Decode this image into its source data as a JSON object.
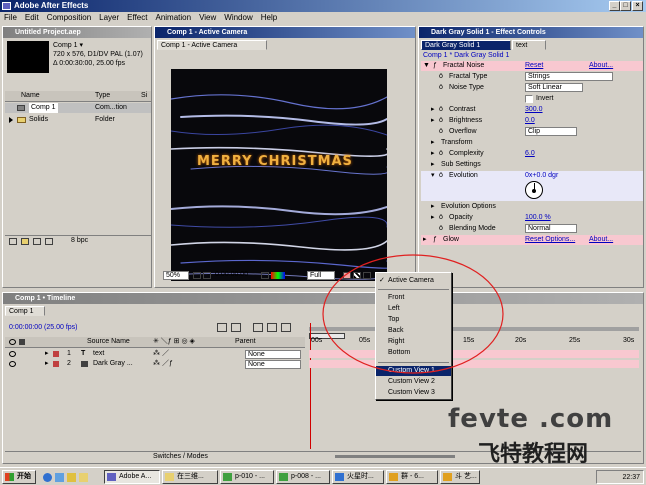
{
  "app": {
    "title": "Adobe After Effects",
    "min": "_",
    "max": "□",
    "close": "×"
  },
  "menu": [
    "File",
    "Edit",
    "Composition",
    "Layer",
    "Effect",
    "Animation",
    "View",
    "Window",
    "Help"
  ],
  "project": {
    "title": "Untitled Project.aep",
    "comp_name": "Comp 1 ▾",
    "comp_info1": "720 x 576, D1/DV PAL (1.07)",
    "comp_info2": "Δ 0:00:30:00, 25.00 fps",
    "col_name": "Name",
    "col_type": "Type",
    "col_size": "Si",
    "items": [
      {
        "name": "Comp 1",
        "type": "Com...tion"
      },
      {
        "name": "Solids",
        "type": "Folder"
      }
    ],
    "bpc": "8 bpc"
  },
  "comp_viewer": {
    "title": "Comp 1 - Active Camera",
    "tab": "Comp 1 - Active Camera",
    "text": "MERRY CHRISTMAS",
    "zoom": "50%",
    "time": "0:00:00:00",
    "resolution": "Full"
  },
  "effect_controls": {
    "title": "Dark Gray Solid 1 - Effect Controls",
    "tab1": "Dark Gray Solid 1",
    "tab2": "text",
    "breadcrumb": "Comp 1 * Dark Gray Solid 1",
    "effect_name": "Fractal Noise",
    "reset": "Reset",
    "about": "About...",
    "props": [
      {
        "label": "Fractal Type",
        "value": "Strings"
      },
      {
        "label": "Noise Type",
        "value": "Soft Linear"
      },
      {
        "label": "",
        "value": "Invert"
      },
      {
        "label": "Contrast",
        "value": "300.0"
      },
      {
        "label": "Brightness",
        "value": "0.0"
      },
      {
        "label": "Overflow",
        "value": "Clip"
      },
      {
        "label": "Transform",
        "value": ""
      },
      {
        "label": "Complexity",
        "value": "6.0"
      },
      {
        "label": "Sub Settings",
        "value": ""
      },
      {
        "label": "Evolution",
        "value": "0x+0.0 dgr"
      },
      {
        "label": "Evolution Options",
        "value": ""
      },
      {
        "label": "Opacity",
        "value": "100.0 %"
      },
      {
        "label": "Blending Mode",
        "value": "Normal"
      }
    ],
    "glow": {
      "name": "Glow",
      "reset": "Reset Options...",
      "about": "About..."
    }
  },
  "timeline": {
    "title": "Comp 1 • Timeline",
    "tab": "Comp 1",
    "time": "0:00:00:00 (25.00 fps)",
    "col_source": "Source Name",
    "col_parent": "Parent",
    "ticks": [
      "00s",
      "05s",
      "10s",
      "15s",
      "20s",
      "25s",
      "30s"
    ],
    "layers": [
      {
        "num": "1",
        "name": "text",
        "parent": "None"
      },
      {
        "num": "2",
        "name": "Dark Gray ...",
        "parent": "None"
      }
    ],
    "switches": "Switches / Modes"
  },
  "view_menu": {
    "checked": "Active Camera",
    "items": [
      "Front",
      "Left",
      "Top",
      "Back",
      "Right",
      "Bottom"
    ],
    "custom": [
      "Custom View 1",
      "Custom View 2",
      "Custom View 3"
    ],
    "selected_index": 0
  },
  "watermark": {
    "line1": "fevte .com",
    "line2": "飞特教程网"
  },
  "taskbar": {
    "start": "开始",
    "items": [
      "Adobe A...",
      "在三维...",
      "p-010 - ...",
      "p-008 - ...",
      "火星时...",
      "群 - 6...",
      "斗 艺..."
    ],
    "clock": "22:37"
  },
  "colors": {
    "accent": "#0a246a",
    "evolution_bg": "#e8e8f8",
    "pink": "#f8c8d0"
  }
}
